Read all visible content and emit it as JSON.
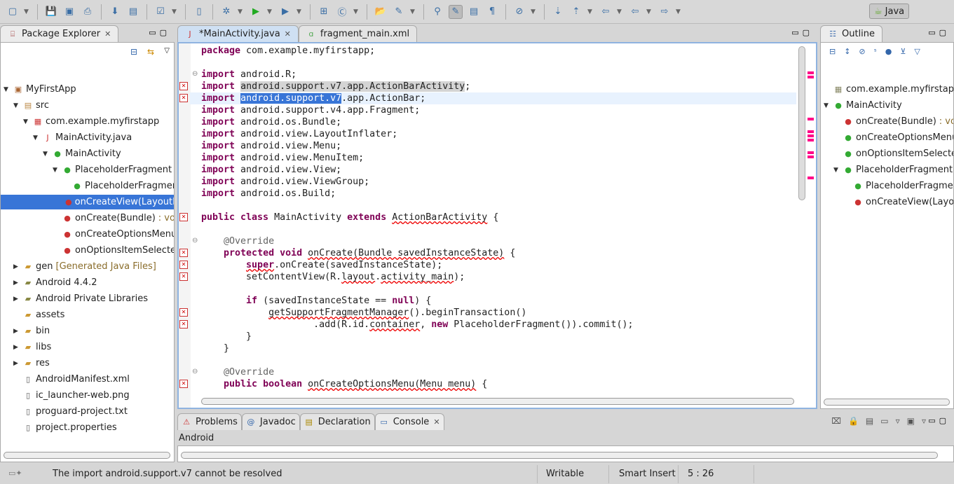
{
  "toolbar": {
    "icons": [
      "new-wizard-icon",
      "save-icon",
      "save-all-icon",
      "print-icon",
      "android-sdk-manager-icon",
      "android-avd-manager-icon",
      "run-lint-icon",
      "new-android-xml-icon",
      "debug-icon",
      "run-icon",
      "run-external-tools-icon",
      "new-java-package-icon",
      "new-java-class-icon",
      "open-type-icon",
      "search-icon",
      "open-task-icon",
      "toggle-mark-occurrences-icon",
      "block-selection-icon",
      "show-whitespace-icon",
      "skip-breakpoints-icon",
      "next-annotation-icon",
      "previous-annotation-icon",
      "last-edit-location-icon",
      "back-icon",
      "forward-icon"
    ],
    "perspective_label": "Java"
  },
  "package_explorer": {
    "title": "Package Explorer",
    "items": [
      {
        "label": "MyFirstApp",
        "decoration": "",
        "level": 0,
        "twisty": "open",
        "icon": "project"
      },
      {
        "label": "src",
        "decoration": "",
        "level": 1,
        "twisty": "open",
        "icon": "src-folder"
      },
      {
        "label": "com.example.myfirstapp",
        "decoration": "",
        "level": 2,
        "twisty": "open",
        "icon": "package-error"
      },
      {
        "label": "MainActivity.java",
        "decoration": "",
        "level": 3,
        "twisty": "open",
        "icon": "java-file-error"
      },
      {
        "label": "MainActivity",
        "decoration": "",
        "level": 4,
        "twisty": "open",
        "icon": "class"
      },
      {
        "label": "PlaceholderFragment",
        "decoration": "",
        "level": 5,
        "twisty": "open",
        "icon": "class-static"
      },
      {
        "label": "PlaceholderFragment()",
        "decoration": "",
        "level": 6,
        "twisty": "",
        "icon": "constructor"
      },
      {
        "label": "onCreateView(LayoutInflater, ViewGroup, Bundle)",
        "decoration": "",
        "level": 6,
        "twisty": "",
        "icon": "method-error",
        "selected": true
      },
      {
        "label": "onCreate(Bundle)",
        "decoration": " : void",
        "level": 5,
        "twisty": "",
        "icon": "method-error"
      },
      {
        "label": "onCreateOptionsMenu(Menu)",
        "decoration": "",
        "level": 5,
        "twisty": "",
        "icon": "method-error"
      },
      {
        "label": "onOptionsItemSelected(MenuItem)",
        "decoration": "",
        "level": 5,
        "twisty": "",
        "icon": "method-error"
      },
      {
        "label": "gen",
        "decoration": " [Generated Java Files]",
        "level": 1,
        "twisty": "closed",
        "icon": "folder"
      },
      {
        "label": "Android 4.4.2",
        "decoration": "",
        "level": 1,
        "twisty": "closed",
        "icon": "library"
      },
      {
        "label": "Android Private Libraries",
        "decoration": "",
        "level": 1,
        "twisty": "closed",
        "icon": "library"
      },
      {
        "label": "assets",
        "decoration": "",
        "level": 1,
        "twisty": "",
        "icon": "folder"
      },
      {
        "label": "bin",
        "decoration": "",
        "level": 1,
        "twisty": "closed",
        "icon": "folder"
      },
      {
        "label": "libs",
        "decoration": "",
        "level": 1,
        "twisty": "closed",
        "icon": "folder"
      },
      {
        "label": "res",
        "decoration": "",
        "level": 1,
        "twisty": "closed",
        "icon": "folder"
      },
      {
        "label": "AndroidManifest.xml",
        "decoration": "",
        "level": 1,
        "twisty": "",
        "icon": "xml-file"
      },
      {
        "label": "ic_launcher-web.png",
        "decoration": "",
        "level": 1,
        "twisty": "",
        "icon": "image-file"
      },
      {
        "label": "proguard-project.txt",
        "decoration": "",
        "level": 1,
        "twisty": "",
        "icon": "text-file"
      },
      {
        "label": "project.properties",
        "decoration": "",
        "level": 1,
        "twisty": "",
        "icon": "text-file"
      }
    ]
  },
  "editor": {
    "tabs": [
      {
        "label": "*MainActivity.java",
        "active": true
      },
      {
        "label": "fragment_main.xml",
        "active": false
      }
    ],
    "current_line": 5,
    "lines": [
      [
        [
          "package",
          "kw"
        ],
        [
          " com.example.myfirstapp;",
          ""
        ]
      ],
      [],
      [
        [
          "import",
          "kw"
        ],
        [
          " android.R;",
          ""
        ]
      ],
      [
        [
          "import",
          "kw"
        ],
        [
          " ",
          ""
        ],
        [
          "android.support.v7.app.ActionBarActivity",
          "hl"
        ],
        [
          ";",
          ""
        ]
      ],
      [
        [
          "import",
          "kw"
        ],
        [
          " ",
          ""
        ],
        [
          "android.support.v7",
          "selx"
        ],
        [
          ".app.ActionBar;",
          ""
        ]
      ],
      [
        [
          "import",
          "kw"
        ],
        [
          " android.support.v4.app.Fragment;",
          ""
        ]
      ],
      [
        [
          "import",
          "kw"
        ],
        [
          " android.os.Bundle;",
          ""
        ]
      ],
      [
        [
          "import",
          "kw"
        ],
        [
          " android.view.LayoutInflater;",
          ""
        ]
      ],
      [
        [
          "import",
          "kw"
        ],
        [
          " android.view.Menu;",
          ""
        ]
      ],
      [
        [
          "import",
          "kw"
        ],
        [
          " android.view.MenuItem;",
          ""
        ]
      ],
      [
        [
          "import",
          "kw"
        ],
        [
          " android.view.View;",
          ""
        ]
      ],
      [
        [
          "import",
          "kw"
        ],
        [
          " android.view.ViewGroup;",
          ""
        ]
      ],
      [
        [
          "import",
          "kw"
        ],
        [
          " android.os.Build;",
          ""
        ]
      ],
      [],
      [
        [
          "public class",
          "kw"
        ],
        [
          " MainActivity ",
          ""
        ],
        [
          "extends",
          "kw"
        ],
        [
          " ",
          ""
        ],
        [
          "ActionBarActivity",
          "err"
        ],
        [
          " {",
          ""
        ]
      ],
      [],
      [
        [
          "    ",
          ""
        ],
        [
          "@Override",
          "ann"
        ]
      ],
      [
        [
          "    ",
          ""
        ],
        [
          "protected void",
          "kw"
        ],
        [
          " ",
          ""
        ],
        [
          "onCreate(Bundle savedInstanceState)",
          "err"
        ],
        [
          " {",
          ""
        ]
      ],
      [
        [
          "        ",
          ""
        ],
        [
          "super",
          "kw err"
        ],
        [
          ".onCreate(savedInstanceState);",
          ""
        ]
      ],
      [
        [
          "        setContentView(R.",
          ""
        ],
        [
          "layout",
          "err"
        ],
        [
          ".",
          ""
        ],
        [
          "activity_main",
          "err"
        ],
        [
          ");",
          ""
        ]
      ],
      [],
      [
        [
          "        ",
          ""
        ],
        [
          "if",
          "kw"
        ],
        [
          " (savedInstanceState == ",
          ""
        ],
        [
          "null",
          "kw"
        ],
        [
          ") {",
          ""
        ]
      ],
      [
        [
          "            ",
          ""
        ],
        [
          "getSupportFragmentManager",
          "err"
        ],
        [
          "().beginTransaction()",
          ""
        ]
      ],
      [
        [
          "                    .add(R.id.",
          ""
        ],
        [
          "container",
          "err"
        ],
        [
          ", ",
          ""
        ],
        [
          "new",
          "kw"
        ],
        [
          " PlaceholderFragment()).commit();",
          ""
        ]
      ],
      [
        [
          "        }",
          ""
        ]
      ],
      [
        [
          "    }",
          ""
        ]
      ],
      [],
      [
        [
          "    ",
          ""
        ],
        [
          "@Override",
          "ann"
        ]
      ],
      [
        [
          "    ",
          ""
        ],
        [
          "public boolean",
          "kw"
        ],
        [
          " ",
          ""
        ],
        [
          "onCreateOptionsMenu(Menu menu)",
          "err"
        ],
        [
          " {",
          ""
        ]
      ]
    ],
    "error_marker_lines": [
      4,
      5,
      15,
      18,
      19,
      20,
      23,
      24,
      29
    ],
    "fold_lines": [
      3,
      17,
      28
    ]
  },
  "outline": {
    "title": "Outline",
    "items": [
      {
        "label": "com.example.myfirstapp",
        "level": 0,
        "twisty": "",
        "icon": "package-declaration"
      },
      {
        "label": "MainActivity",
        "level": 0,
        "twisty": "open",
        "icon": "class-error"
      },
      {
        "label": "onCreate(Bundle)",
        "decoration": " : void",
        "level": 1,
        "twisty": "",
        "icon": "method-error"
      },
      {
        "label": "onCreateOptionsMenu(Menu)",
        "level": 1,
        "twisty": "",
        "icon": "method"
      },
      {
        "label": "onOptionsItemSelected(MenuItem)",
        "level": 1,
        "twisty": "",
        "icon": "method"
      },
      {
        "label": "PlaceholderFragment",
        "level": 1,
        "twisty": "open",
        "icon": "class-static-error"
      },
      {
        "label": "PlaceholderFragment()",
        "level": 2,
        "twisty": "",
        "icon": "constructor"
      },
      {
        "label": "onCreateView(LayoutInflater, ViewGroup, Bundle)",
        "level": 2,
        "twisty": "",
        "icon": "method-error"
      }
    ]
  },
  "bottom": {
    "tabs": [
      {
        "label": "Problems"
      },
      {
        "label": "Javadoc"
      },
      {
        "label": "Declaration"
      },
      {
        "label": "Console",
        "active": true
      }
    ],
    "console_name": "Android"
  },
  "status": {
    "message": "The import android.support.v7 cannot be resolved",
    "writable": "Writable",
    "insert_mode": "Smart Insert",
    "position": "5 : 26"
  }
}
